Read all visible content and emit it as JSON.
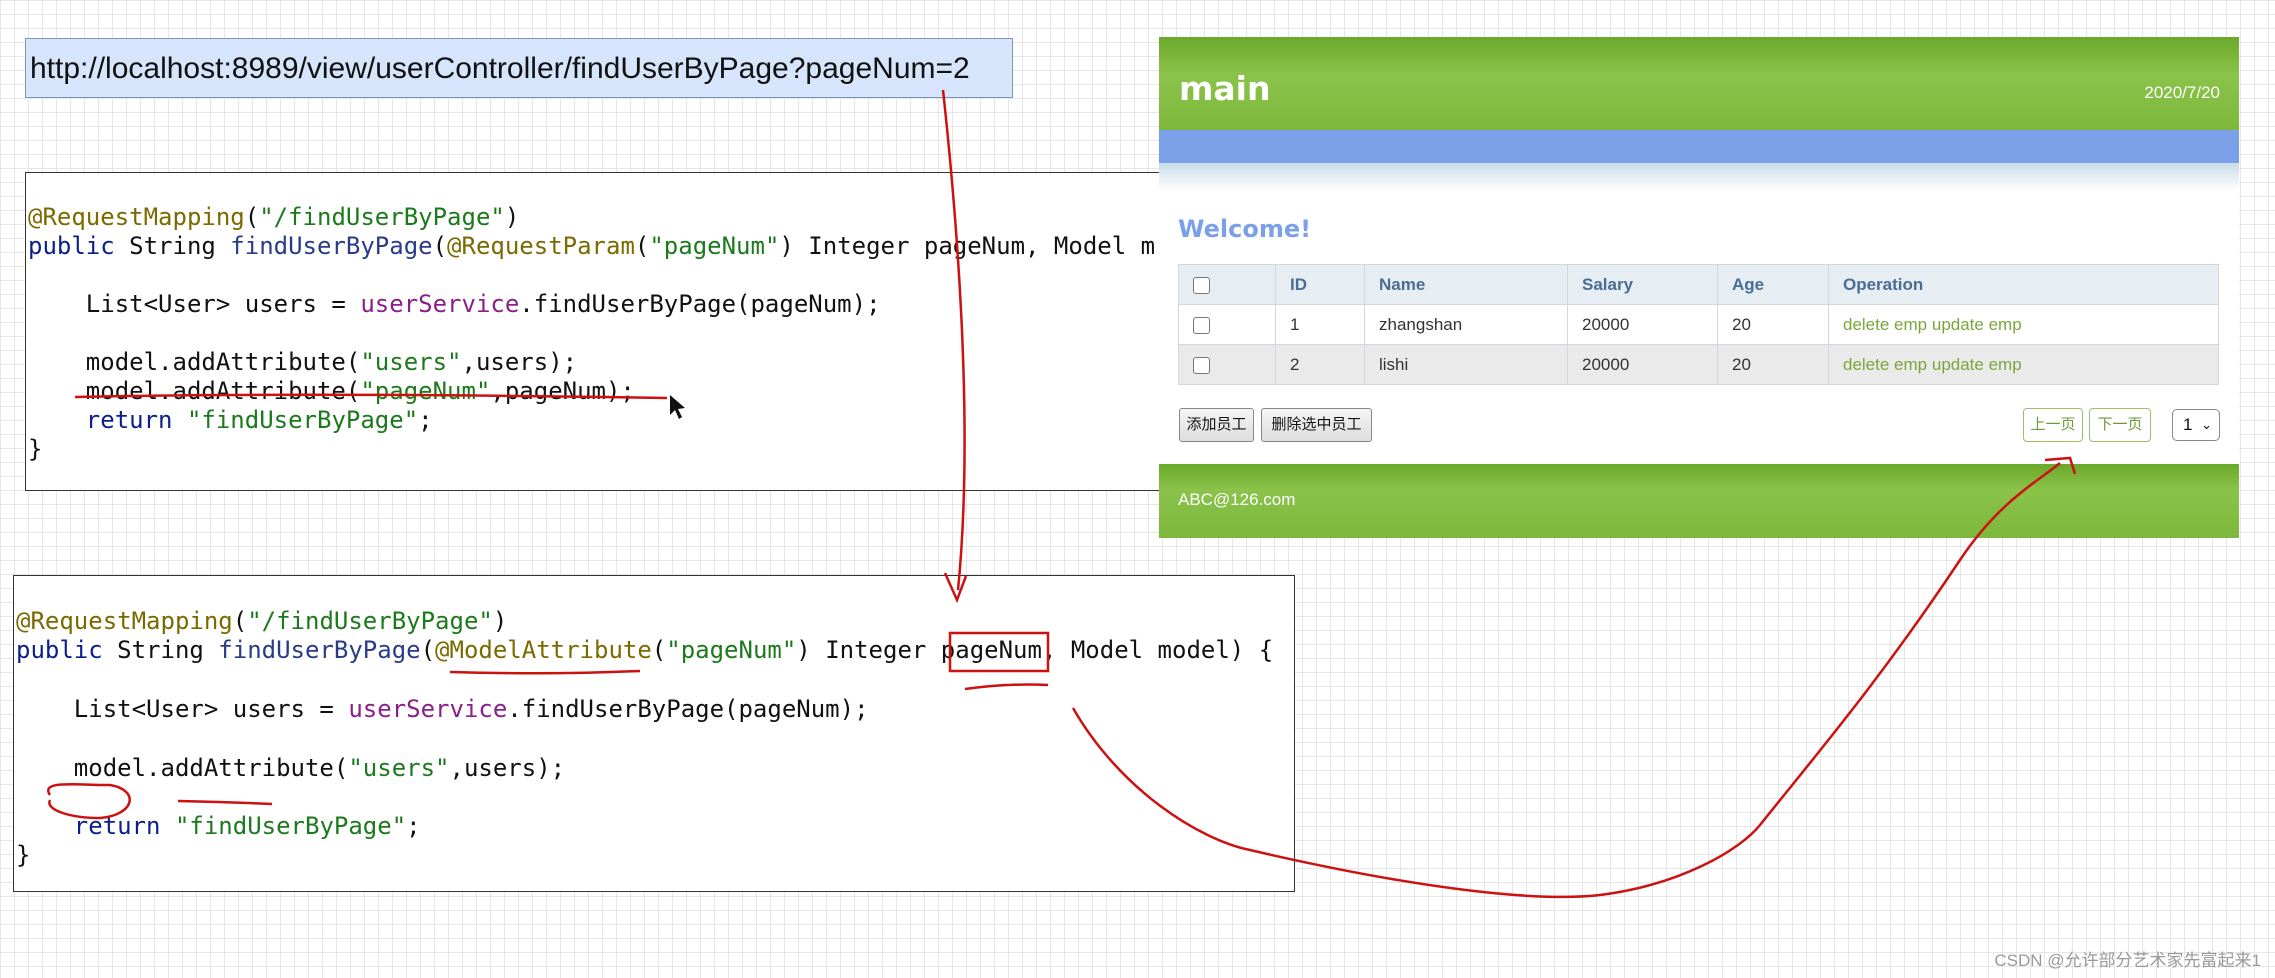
{
  "url_bar": {
    "text": "http://localhost:8989/view/userController/findUserByPage?pageNum=2"
  },
  "code_top": {
    "l1": {
      "ann": "@RequestMapping",
      "rest": "(",
      "str": "\"/findUserByPage\"",
      "end": ")"
    },
    "l2": {
      "kw": "public",
      "t1": " String ",
      "fn": "findUserByPage",
      "t2": "(",
      "ann": "@RequestParam",
      "t3": "(",
      "str": "\"pageNum\"",
      "t4": ") Integer pageNum, Model m"
    },
    "l3": {
      "t1": "    List<User> users = ",
      "svc": "userService",
      "t2": ".findUserByPage(pageNum);"
    },
    "l4": {
      "t1": "    model.addAttribute(",
      "str": "\"users\"",
      "t2": ",users);"
    },
    "l5": {
      "t1": "    model.addAttribute(",
      "str": "\"pageNum\"",
      "t2": ",pageNum);"
    },
    "l6": {
      "kw": "    return",
      "t1": " ",
      "str": "\"findUserByPage\"",
      "t2": ";"
    },
    "l7": {
      "t1": "}"
    }
  },
  "code_bottom": {
    "l1": {
      "ann": "@RequestMapping",
      "rest": "(",
      "str": "\"/findUserByPage\"",
      "end": ")"
    },
    "l2": {
      "kw": "public",
      "t1": " String ",
      "fn": "findUserByPage",
      "t2": "(",
      "ann": "@ModelAttribute",
      "t3": "(",
      "str": "\"pageNum\"",
      "t4": ") Integer ",
      "t5": "pageNum",
      "t6": ", Model model) {"
    },
    "l3": {
      "t1": "    List<User> users = ",
      "svc": "userService",
      "t2": ".findUserByPage(pageNum);"
    },
    "l4": {
      "t1": "    model.addAttribute(",
      "str": "\"users\"",
      "t2": ",users);"
    },
    "l5": {
      "kw": "    return",
      "t1": " ",
      "str": "\"findUserByPage\"",
      "t2": ";"
    },
    "l6": {
      "t1": "}"
    }
  },
  "app": {
    "title": "main",
    "date": "2020/7/20",
    "welcome": "Welcome!",
    "table": {
      "headers": [
        "ID",
        "Name",
        "Salary",
        "Age",
        "Operation"
      ],
      "rows": [
        {
          "id": "1",
          "name": "zhangshan",
          "salary": "20000",
          "age": "20",
          "delete": "delete emp",
          "update": "update emp"
        },
        {
          "id": "2",
          "name": "lishi",
          "salary": "20000",
          "age": "20",
          "delete": "delete emp",
          "update": "update emp"
        }
      ]
    },
    "buttons": {
      "add": "添加员工",
      "delete_selected": "删除选中员工",
      "prev": "上一页",
      "next": "下一页"
    },
    "page_select": "1",
    "footer": "ABC@126.com"
  },
  "watermark": "CSDN @允许部分艺术家先富起来1",
  "colors": {
    "header_green": "#8bc34a",
    "band_blue": "#7aa0e8",
    "annotation_red": "#cc1111"
  }
}
